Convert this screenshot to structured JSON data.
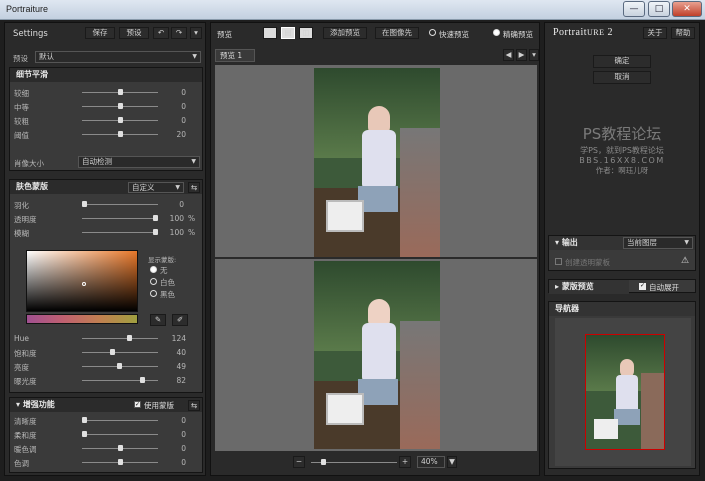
{
  "window": {
    "title": "Portraiture",
    "min": "—",
    "max": "□",
    "close": "✕"
  },
  "left": {
    "settings_label": "Settings",
    "save": "保存",
    "preset_btn": "预设",
    "undo": "↶",
    "redo": "↷",
    "preset_label": "预设",
    "preset_value": "默认",
    "detail": {
      "title": "细节平滑",
      "rows": [
        {
          "label": "较细",
          "value": "0",
          "pos": 0.5
        },
        {
          "label": "中等",
          "value": "0",
          "pos": 0.5
        },
        {
          "label": "较粗",
          "value": "0",
          "pos": 0.5
        },
        {
          "label": "阈值",
          "value": "20",
          "pos": 0.5
        }
      ],
      "size_label": "肖像大小",
      "size_value": "自动检测"
    },
    "skin": {
      "title": "肤色蒙版",
      "mode": "自定义",
      "pick": "⇆",
      "rows": [
        {
          "label": "羽化",
          "value": "0",
          "unit": "",
          "pos": 0.0
        },
        {
          "label": "透明度",
          "value": "100",
          "unit": "%",
          "pos": 1.0
        },
        {
          "label": "模糊",
          "value": "100",
          "unit": "%",
          "pos": 1.0
        }
      ],
      "show_mask": "显示蒙版:",
      "opts": [
        "无",
        "白色",
        "黑色"
      ],
      "hsl": [
        {
          "label": "Hue",
          "value": "124",
          "pos": 0.64
        },
        {
          "label": "饱和度",
          "value": "40",
          "pos": 0.4
        },
        {
          "label": "亮度",
          "value": "49",
          "pos": 0.49
        },
        {
          "label": "曝光度",
          "value": "82",
          "pos": 0.82
        }
      ]
    },
    "enhance": {
      "title": "增强功能",
      "use_mask": "使用蒙版",
      "rows": [
        {
          "label": "清晰度",
          "value": "0",
          "pos": 0.0
        },
        {
          "label": "柔和度",
          "value": "0",
          "pos": 0.0
        },
        {
          "label": "暖色调",
          "value": "0",
          "pos": 0.5
        },
        {
          "label": "色调",
          "value": "0",
          "pos": 0.5
        }
      ]
    }
  },
  "center": {
    "title": "预览",
    "add_preview": "添加预览",
    "bg_color": "在图像先",
    "fast": "快速预览",
    "precise": "精确预览",
    "tab": "预览 1",
    "zoom": "40%",
    "minus": "−",
    "plus": "+"
  },
  "right": {
    "logo_a": "Portrait",
    "logo_b": "ure",
    "logo_ver": "2",
    "about": "关于",
    "help": "帮助",
    "ok": "确定",
    "cancel": "取消",
    "watermark": {
      "title": "PS教程论坛",
      "line1": "学PS，就到PS教程论坛",
      "line2": "BBS.16XX8.COM",
      "line3": "作者：啊珏儿呀"
    },
    "output_label": "输出",
    "output_value": "当前图层",
    "new_layer": "创建透明蒙板",
    "mask_preview": "蒙版预览",
    "auto_expand": "自动展开",
    "navigator": "导航器"
  }
}
